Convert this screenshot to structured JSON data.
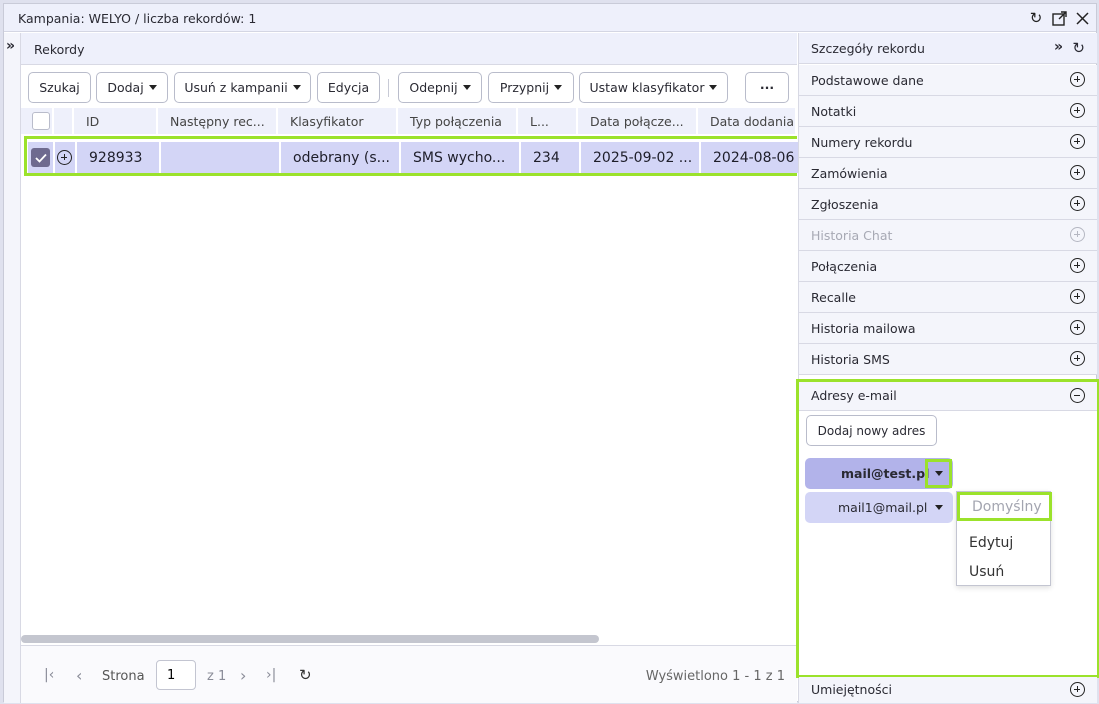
{
  "window": {
    "title": "Kampania: WELYO / liczba rekordów: 1"
  },
  "left_panel": {
    "title": "Rekordy"
  },
  "toolbar": {
    "search": "Szukaj",
    "add": "Dodaj",
    "remove": "Usuń z kampanii",
    "edit": "Edycja",
    "unpin": "Odepnij",
    "pin": "Przypnij",
    "set_classifier": "Ustaw klasyfikator",
    "more": "···"
  },
  "grid": {
    "columns": [
      "ID",
      "Następny rec...",
      "Klasyfikator",
      "Typ połączenia",
      "L...",
      "Data połącze...",
      "Data dodania..."
    ],
    "rows": [
      {
        "id": "928933",
        "next": "",
        "classifier": "odebrany (s...",
        "type": "SMS wycho...",
        "l": "234",
        "conn_date": "2025-09-02 ...",
        "added_date": "2024-08-06"
      }
    ]
  },
  "pager": {
    "page_label": "Strona",
    "page": "1",
    "of": "z 1",
    "displayed": "Wyświetlono 1 - 1 z 1"
  },
  "details": {
    "title": "Szczegóły rekordu",
    "sections": [
      "Podstawowe dane",
      "Notatki",
      "Numery rekordu",
      "Zamówienia",
      "Zgłoszenia",
      "Historia Chat",
      "Połączenia",
      "Recalle",
      "Historia mailowa",
      "Historia SMS"
    ],
    "disabled_section": "Historia Chat",
    "email_section": {
      "title": "Adresy e-mail",
      "add_button": "Dodaj nowy adres",
      "addresses": [
        "mail@test.pl",
        "mail1@mail.pl"
      ],
      "menu": [
        "Domyślny",
        "Edytuj",
        "Usuń"
      ]
    },
    "last_section": "Umiejętności"
  },
  "colors": {
    "accent_highlight": "#9be22b",
    "selected_row": "#d3d5f6",
    "selected_email": "#b2b3ea"
  }
}
